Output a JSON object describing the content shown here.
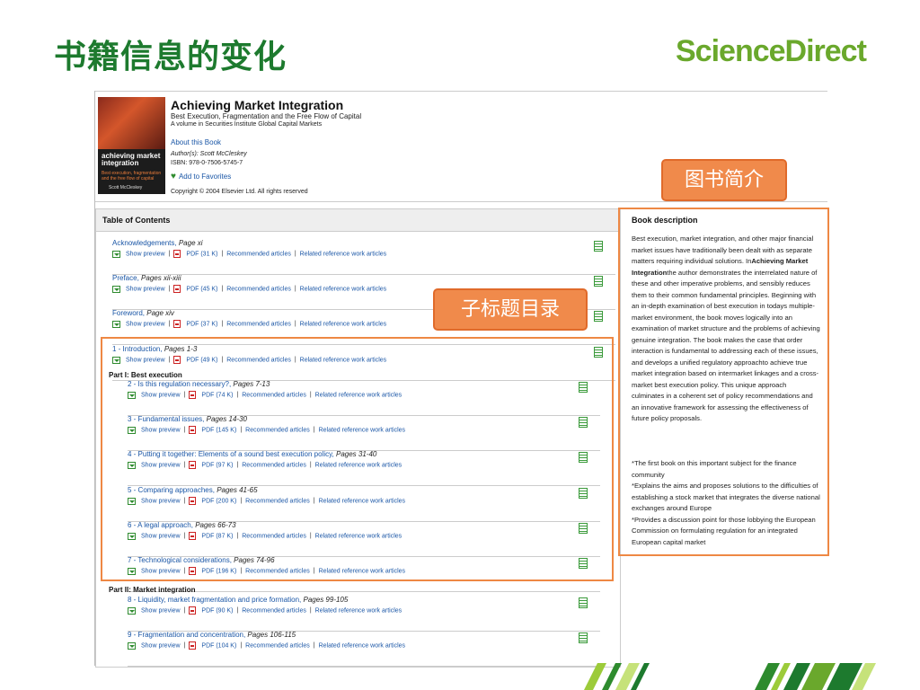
{
  "slide": {
    "title": "书籍信息的变化",
    "brand": "ScienceDirect"
  },
  "book": {
    "title": "Achieving Market Integration",
    "subtitle": "Best Execution, Fragmentation and the Free Flow of Capital",
    "volume": "A volume in Securities Institute Global Capital Markets",
    "about": "About this Book",
    "authors": "Author(s): Scott McCleskey",
    "isbn": "ISBN: 978-0-7506-5745-7",
    "favorites": "Add to Favorites",
    "copyright": "Copyright © 2004 Elsevier Ltd. All rights reserved",
    "cover_title": "achieving market integration",
    "cover_sub": "Best execution, fragmentation and the free flow of capital",
    "cover_author": "Scott McCleskey"
  },
  "callouts": {
    "intro": "图书简介",
    "toc": "子标题目录"
  },
  "toc": {
    "heading": "Table of Contents",
    "link_preview": "Show preview",
    "link_recommended": "Recommended articles",
    "link_related": "Related reference work articles",
    "sep": "|",
    "part1": "Part I: Best execution",
    "part2": "Part II: Market integration",
    "entries": [
      {
        "title": "Acknowledgements,",
        "pages": "Page xi",
        "pdf": "PDF (31 K)"
      },
      {
        "title": "Preface,",
        "pages": "Pages xii-xiii",
        "pdf": "PDF (45 K)"
      },
      {
        "title": "Foreword,",
        "pages": "Page xiv",
        "pdf": "PDF (37 K)"
      },
      {
        "title": "1 - Introduction,",
        "pages": "Pages 1-3",
        "pdf": "PDF (49 K)"
      },
      {
        "title": "2 - Is this regulation necessary?,",
        "pages": "Pages 7-13",
        "pdf": "PDF (74 K)"
      },
      {
        "title": "3 - Fundamental issues,",
        "pages": "Pages 14-30",
        "pdf": "PDF (145 K)"
      },
      {
        "title": "4 - Putting it together: Elements of a sound best execution policy,",
        "pages": "Pages 31-40",
        "pdf": "PDF (97 K)"
      },
      {
        "title": "5 - Comparing approaches,",
        "pages": "Pages 41-65",
        "pdf": "PDF (200 K)"
      },
      {
        "title": "6 - A legal approach,",
        "pages": "Pages 66-73",
        "pdf": "PDF (87 K)"
      },
      {
        "title": "7 - Technological considerations,",
        "pages": "Pages 74-96",
        "pdf": "PDF (196 K)"
      },
      {
        "title": "8 - Liquidity, market fragmentation and price formation,",
        "pages": "Pages 99-105",
        "pdf": "PDF (90 K)"
      },
      {
        "title": "9 - Fragmentation and concentration,",
        "pages": "Pages 106-115",
        "pdf": "PDF (104 K)"
      }
    ]
  },
  "description": {
    "title": "Book description",
    "body_pre": "Best execution, market integration, and other major financial market issues have traditionally been dealt with as separate matters requiring individual solutions. In",
    "body_bold": "Achieving Market Integration",
    "body_post": "the author demonstrates the interrelated nature of these and other imperative problems, and sensibly reduces them to their common fundamental principles. Beginning with an in-depth examination of best execution in todays multiple-market environment, the book moves logically into an examination of market structure and the problems of achieving genuine integration. The book makes the case that order interaction is fundamental to addressing each of these issues, and develops a unified regulatory approachto achieve true market integration based on intermarket linkages and a cross-market best execution policy. This unique approach culminates in a coherent set of policy recommendations and an innovative framework for assessing the effectiveness of future policy proposals.",
    "bullets": [
      "*The first book on this important subject for the finance community",
      "*Explains the aims and proposes solutions to the difficulties of establishing a stock market that integrates the diverse national exchanges around Europe",
      "*Provides a discussion point for those lobbying the European Commission on formulating regulation for an integrated European capital market"
    ]
  },
  "colors": {
    "title_green": "#1d7a2e",
    "brand_green": "#6aa82c",
    "callout_orange": "#f08a4b",
    "link_blue": "#1a56a6"
  }
}
